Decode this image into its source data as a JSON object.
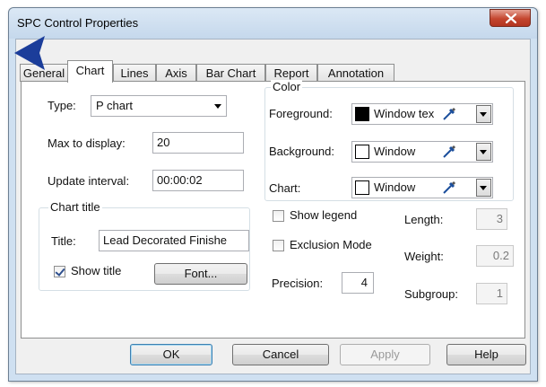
{
  "window": {
    "title": "SPC Control Properties"
  },
  "tabs": [
    "General",
    "Chart",
    "Lines",
    "Axis",
    "Bar Chart",
    "Report",
    "Annotation"
  ],
  "active_tab": "Chart",
  "chart_tab": {
    "type_label": "Type:",
    "type_value": "P chart",
    "max_label": "Max to display:",
    "max_value": "20",
    "interval_label": "Update interval:",
    "interval_value": "00:00:02",
    "chart_title_group": "Chart title",
    "title_label": "Title:",
    "title_value": "Lead Decorated Finishe",
    "show_title_label": "Show title",
    "show_title_checked": true,
    "font_button": "Font...",
    "color_group": "Color",
    "foreground_label": "Foreground:",
    "foreground_value": "Window tex",
    "foreground_color": "#000000",
    "background_label": "Background:",
    "background_value": "Window",
    "background_color": "#ffffff",
    "chart_label": "Chart:",
    "chart_value": "Window",
    "chart_color": "#ffffff",
    "show_legend_label": "Show legend",
    "show_legend_checked": false,
    "exclusion_label": "Exclusion Mode",
    "exclusion_checked": false,
    "precision_label": "Precision:",
    "precision_value": "4",
    "length_label": "Length:",
    "length_value": "3",
    "weight_label": "Weight:",
    "weight_value": "0.2",
    "subgroup_label": "Subgroup:",
    "subgroup_value": "1"
  },
  "buttons": {
    "ok": "OK",
    "cancel": "Cancel",
    "apply": "Apply",
    "help": "Help"
  },
  "colors": {
    "titlebar": "#c5d8ec",
    "close": "#c4462f",
    "pointer": "#1b3d9a"
  }
}
